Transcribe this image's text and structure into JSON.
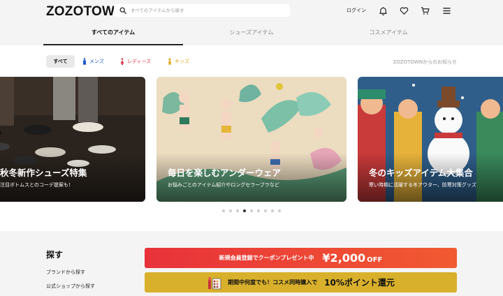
{
  "header": {
    "logo": "ZOZOTOWN",
    "search_placeholder": "すべてのアイテムから探す",
    "login_label": "ログイン",
    "icons": [
      "bell-icon",
      "heart-icon",
      "cart-icon",
      "menu-icon"
    ]
  },
  "tabs": [
    {
      "label": "すべてのアイテム",
      "active": true
    },
    {
      "label": "シューズアイテム",
      "active": false
    },
    {
      "label": "コスメアイテム",
      "active": false
    }
  ],
  "gender_filter": {
    "all": "すべて",
    "men": "メンズ",
    "ladies": "レディース",
    "kids": "キッズ",
    "colors": {
      "men": "#1f5bc6",
      "ladies": "#e0384a",
      "kids": "#e0a81d"
    }
  },
  "notice_link": "ZOZOTOWNからのお知らせ",
  "carousel": {
    "cards": [
      {
        "title": "秋冬新作シューズ特集",
        "subtitle": "注目ボトムスとのコーデ提案も！"
      },
      {
        "title": "毎日を楽しむアンダーウェア",
        "subtitle": "お悩みごとのアイテム紹介やロングセラーブラなど"
      },
      {
        "title": "冬のキッズアイテム大集合",
        "subtitle": "寒い時期に活躍する冬アウター、防寒対策グッズ"
      }
    ],
    "dot_count": 9,
    "active_dot": 3
  },
  "search_section": {
    "title": "探す",
    "links": [
      "ブランドから探す",
      "公式ショップから探す"
    ]
  },
  "banners": {
    "coupon": {
      "text": "新規会員登録でクーポンプレゼント中",
      "amount": "¥2,000",
      "suffix": "OFF"
    },
    "cosme": {
      "text": "期間中何度でも！コスメ同時購入で",
      "highlight": "10%ポイント還元"
    }
  }
}
